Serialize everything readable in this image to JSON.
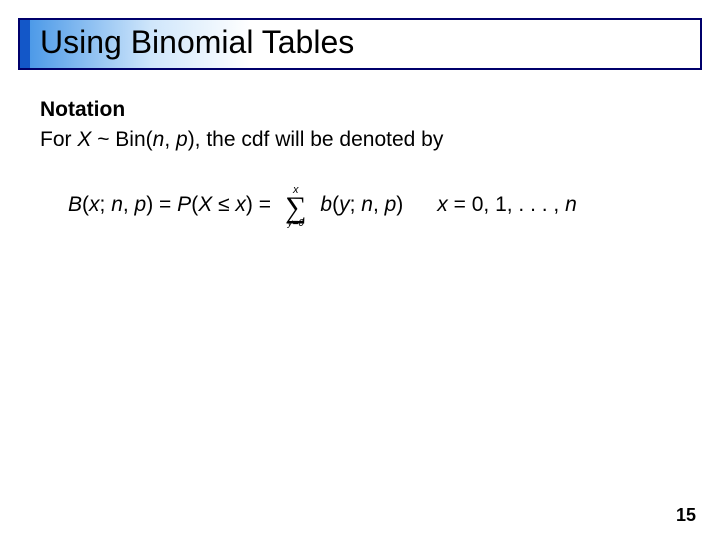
{
  "title": "Using Binomial Tables",
  "body": {
    "notation_heading": "Notation",
    "notation_line_pre": "For ",
    "notation_X": "X",
    "notation_tilde": " ~ Bin(",
    "notation_n": "n",
    "notation_comma": ", ",
    "notation_p": "p",
    "notation_line_post": "), the cdf will be denoted by"
  },
  "formula": {
    "lhs_B": "B",
    "lhs_open": "(",
    "lhs_x": "x",
    "lhs_sep1": "; ",
    "lhs_n": "n",
    "lhs_sep2": ", ",
    "lhs_p": "p",
    "lhs_close_eq": ") = ",
    "P": "P",
    "P_open": "(",
    "P_X": "X",
    "P_le": " ≤ ",
    "P_x": "x",
    "P_close_eq": ") = ",
    "sum_top": "x",
    "sum_sigma": "∑",
    "sum_bottom": "y=0",
    "rhs_b": "b",
    "rhs_open": "(",
    "rhs_y": "y",
    "rhs_sep1": "; ",
    "rhs_n": "n",
    "rhs_sep2": ", ",
    "rhs_p": "p",
    "rhs_close": ")",
    "range_x": "x",
    "range_eq": " = 0, 1, . . . , ",
    "range_n": "n"
  },
  "page_number": "15"
}
